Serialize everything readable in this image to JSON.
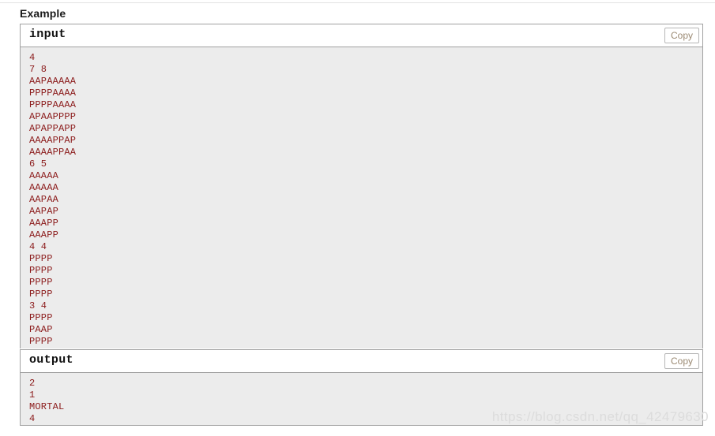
{
  "section": {
    "title": "Example"
  },
  "blocks": [
    {
      "id": "input",
      "label": "input",
      "copy_label": "Copy",
      "lines": [
        "4",
        "7 8",
        "AAPAAAAA",
        "PPPPAAAA",
        "PPPPAAAA",
        "APAAPPPP",
        "APAPPAPP",
        "AAAAPPAP",
        "AAAAPPAA",
        "6 5",
        "AAAAA",
        "AAAAA",
        "AAPAA",
        "AAPAP",
        "AAAPP",
        "AAAPP",
        "4 4",
        "PPPP",
        "PPPP",
        "PPPP",
        "PPPP",
        "3 4",
        "PPPP",
        "PAAP",
        "PPPP"
      ]
    },
    {
      "id": "output",
      "label": "output",
      "copy_label": "Copy",
      "lines": [
        "2",
        "1",
        "MORTAL",
        "4"
      ]
    }
  ],
  "watermark": {
    "text": "https://blog.csdn.net/qq_42479630"
  },
  "colors": {
    "code_text": "#8b1a1a",
    "code_background": "#ececec",
    "border": "#a0a0a0",
    "copy_text": "#9b8a73",
    "watermark": "#dcdcdc"
  }
}
